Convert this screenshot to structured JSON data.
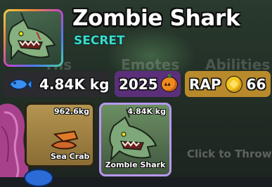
{
  "item": {
    "name": "Zombie Shark",
    "rarity": "SECRET",
    "rarity_color": "#3fd9c8"
  },
  "stats": {
    "weight": {
      "icon": "fish-icon",
      "value": "4.84K kg"
    },
    "year": {
      "value": "2025",
      "icon": "pumpkin-icon"
    },
    "rap": {
      "label": "RAP",
      "icon": "coin-icon",
      "value": "66"
    }
  },
  "background_tabs": [
    "rns",
    "Emotes",
    "Abilities"
  ],
  "inventory": [
    {
      "name": "Sea Crab",
      "weight": "962.6kg"
    },
    {
      "name": "Zombie Shark",
      "weight": "4.84K kg",
      "selected": true
    }
  ],
  "hint": "Click to Throw"
}
